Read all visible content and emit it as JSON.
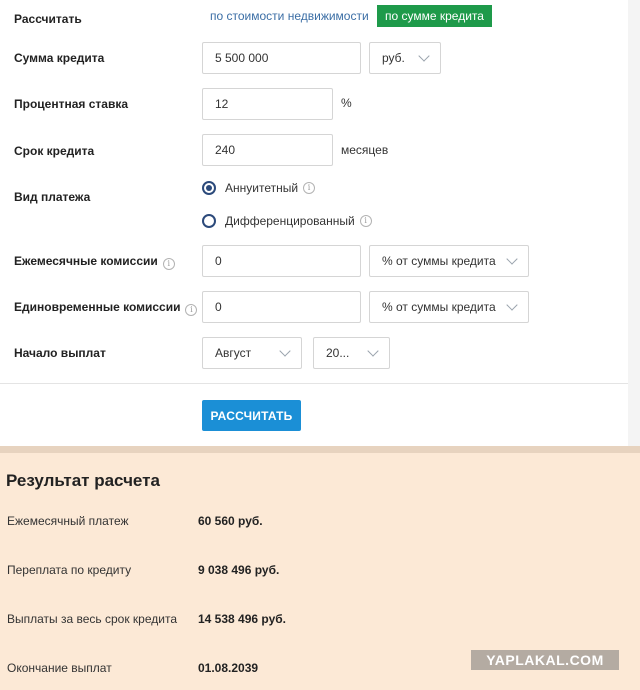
{
  "calc_by": {
    "label": "Рассчитать",
    "option_property": "по стоимости недвижимости",
    "option_loan": "по сумме кредита"
  },
  "loan_amount": {
    "label": "Сумма кредита",
    "value": "5 500 000",
    "currency": "руб."
  },
  "rate": {
    "label": "Процентная ставка",
    "value": "12",
    "unit": "%"
  },
  "term": {
    "label": "Срок кредита",
    "value": "240",
    "unit": "месяцев"
  },
  "payment_type": {
    "label": "Вид платежа",
    "option_annuity": "Аннуитетный",
    "option_diff": "Дифференцированный",
    "selected": "Аннуитетный"
  },
  "monthly_fee": {
    "label": "Ежемесячные комиссии",
    "value": "0",
    "unit": "% от суммы кредита"
  },
  "onetime_fee": {
    "label": "Единовременные комиссии",
    "value": "0",
    "unit": "% от суммы кредита"
  },
  "start": {
    "label": "Начало выплат",
    "month": "Август",
    "year": "20..."
  },
  "button": {
    "label": "РАССЧИТАТЬ"
  },
  "result": {
    "title": "Результат расчета",
    "rows": [
      {
        "label": "Ежемесячный платеж",
        "value": "60 560 руб."
      },
      {
        "label": "Переплата по кредиту",
        "value": "9 038 496 руб."
      },
      {
        "label": "Выплаты за весь срок кредита",
        "value": "14 538 496 руб."
      },
      {
        "label": "Окончание выплат",
        "value": "01.08.2039"
      }
    ]
  },
  "watermark": "YAPLAKAL.COM",
  "colors": {
    "accent_green": "#1e9a4a",
    "button_blue": "#1b8fd6",
    "radio_navy": "#2c4a7b",
    "result_bg": "#fce9d6"
  }
}
